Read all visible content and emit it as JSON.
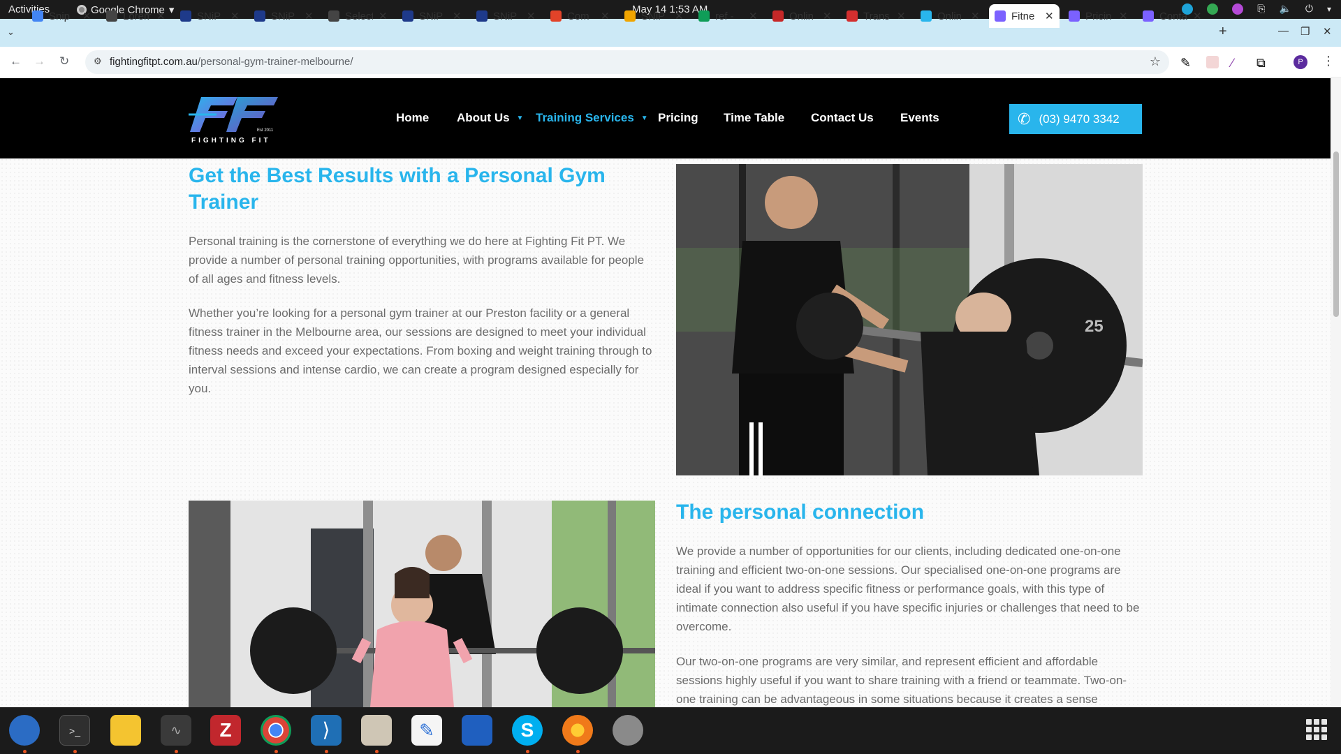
{
  "topbar": {
    "activities": "Activities",
    "app_name": "Google Chrome",
    "clock": "May 14  1:53 AM"
  },
  "tabs": [
    {
      "title": "Snip",
      "fav_color": "#4285f4"
    },
    {
      "title": "Lorem",
      "fav_color": "#444444"
    },
    {
      "title": "SNiP",
      "fav_color": "#1e3a8a"
    },
    {
      "title": "SNiP",
      "fav_color": "#1e3a8a"
    },
    {
      "title": "Select",
      "fav_color": "#444444"
    },
    {
      "title": "SNiP",
      "fav_color": "#1e3a8a"
    },
    {
      "title": "SNiP",
      "fav_color": "#1e3a8a"
    },
    {
      "title": "Com",
      "fav_color": "#e24329"
    },
    {
      "title": "SNiP",
      "fav_color": "#f0a500"
    },
    {
      "title": "ref -",
      "fav_color": "#0f9d58"
    },
    {
      "title": "Onlin",
      "fav_color": "#c62828"
    },
    {
      "title": "Trans",
      "fav_color": "#d32f2f"
    },
    {
      "title": "Onlin",
      "fav_color": "#29b5ec"
    },
    {
      "title": "Fitne",
      "fav_color": "#7b61ff",
      "active": true
    },
    {
      "title": "Pricin",
      "fav_color": "#7b61ff"
    },
    {
      "title": "Conta",
      "fav_color": "#7b61ff"
    }
  ],
  "omnibox": {
    "domain": "fightingfitpt.com.au",
    "path": "/personal-gym-trainer-melbourne/"
  },
  "profile_initial": "P",
  "site": {
    "logo_brand": "FIGHTING FIT",
    "logo_est": "Est 2011",
    "nav": {
      "home": "Home",
      "about": "About Us",
      "training": "Training Services",
      "pricing": "Pricing",
      "timetable": "Time Table",
      "contact": "Contact Us",
      "events": "Events"
    },
    "phone": "(03) 9470 3342",
    "accent_color": "#29b5ec"
  },
  "content": {
    "heading1": "Get the Best Results with a Personal Gym Trainer",
    "para1": "Personal training is the cornerstone of everything we do here at Fighting Fit PT. We provide a number of personal training opportunities, with programs available for people of all ages and fitness levels.",
    "para2": "Whether you’re looking for a personal gym trainer at our Preston facility  or a general fitness trainer in the Melbourne area, our sessions are designed to meet your individual fitness needs and exceed your expectations. From boxing and weight training through to interval sessions and intense cardio, we can create a program designed especially for you.",
    "heading2": "The personal connection",
    "para3": "We provide a number of opportunities for our clients, including dedicated one-on-one training and efficient two-on-one sessions. Our specialised one-on-one programs are ideal if you want to address specific fitness or performance goals, with this type of intimate connection also useful if you have specific injuries or challenges that need to be overcome.",
    "para4": "Our two-on-one programs are very similar, and represent efficient and affordable sessions highly useful if you want to share training with a friend or teammate. Two-on-one training can be advantageous in some situations because it creates a sense"
  },
  "plates": {
    "plate_25": "25"
  }
}
